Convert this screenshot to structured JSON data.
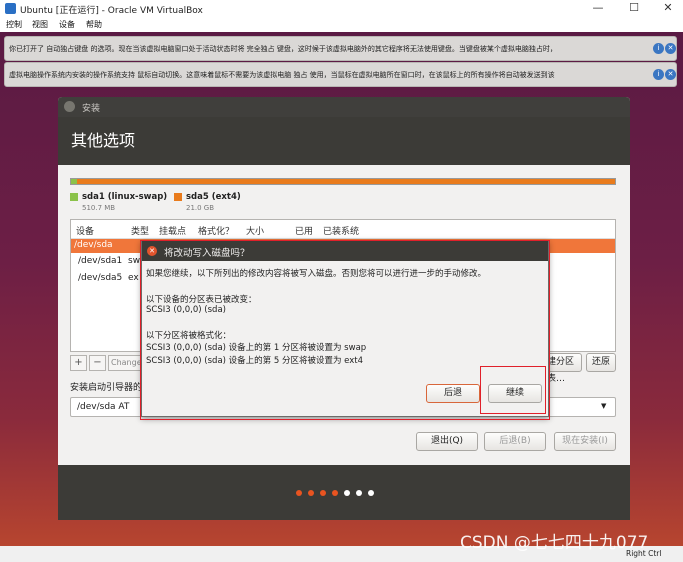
{
  "window": {
    "title": "Ubuntu [正在运行] - Oracle VM VirtualBox",
    "minimize": "—",
    "maximize": "☐",
    "close": "✕"
  },
  "menu": [
    "控制",
    "视图",
    "设备",
    "帮助"
  ],
  "notices": [
    {
      "text": "你已打开了 自动独占键盘 的选项。现在当该虚拟电脑窗口处于活动状态时将 完全独占 键盘，这时候于该虚拟电脑外的其它程序将无法使用键盘。当键盘被某个虚拟电脑独占时，"
    },
    {
      "text": "虚拟电脑操作系统内安装的操作系统支持 鼠标自动切换。这意味着鼠标不需要为该虚拟电脑 独占 使用，当鼠标在虚拟电脑所在窗口时，在该鼠标上的所有操作将自动被发送到该"
    }
  ],
  "installer": {
    "title": "安装",
    "heading": "其他选项",
    "legend": [
      {
        "label": "sda1 (linux-swap)",
        "size": "510.7 MB",
        "color": "#8bc24a"
      },
      {
        "label": "sda5 (ext4)",
        "size": "21.0 GB",
        "color": "#e97b1c"
      }
    ],
    "columns": [
      "设备",
      "类型",
      "挂载点",
      "格式化？",
      "大小",
      "已用",
      "已装系统"
    ],
    "rows": [
      {
        "device": "/dev/sda",
        "rest": ""
      },
      {
        "device": "/dev/sda1",
        "rest": "sw"
      },
      {
        "device": "/dev/sda5",
        "rest": "ex"
      }
    ],
    "tools": {
      "add": "+",
      "remove": "−",
      "change": "Change…",
      "new_table": "新建分区表…",
      "revert": "还原"
    },
    "bootloader_label": "安装启动引导器的设备：",
    "bootloader_value": "/dev/sda   AT",
    "buttons": {
      "quit": "退出(Q)",
      "back": "后退(B)",
      "install": "现在安装(I)"
    },
    "dots": [
      "#e95420",
      "#e95420",
      "#e95420",
      "#e95420",
      "#ffffff",
      "#ffffff",
      "#ffffff"
    ]
  },
  "dialog": {
    "title": "将改动写入磁盘吗？",
    "intro": "如果您继续，以下所列出的修改内容将被写入磁盘。否则您将可以进行进一步的手动修改。",
    "pt_heading": "以下设备的分区表已被改变：",
    "pt_item": "SCSI3 (0,0,0) (sda)",
    "fmt_heading": "以下分区将被格式化：",
    "fmt_items": [
      "SCSI3 (0,0,0) (sda) 设备上的第 1 分区将被设置为 swap",
      "SCSI3 (0,0,0) (sda) 设备上的第 5 分区将被设置为 ext4"
    ],
    "back": "后退",
    "continue": "继续"
  },
  "status": {
    "host_key": "Right Ctrl"
  },
  "watermark": "CSDN @七七四十九077"
}
